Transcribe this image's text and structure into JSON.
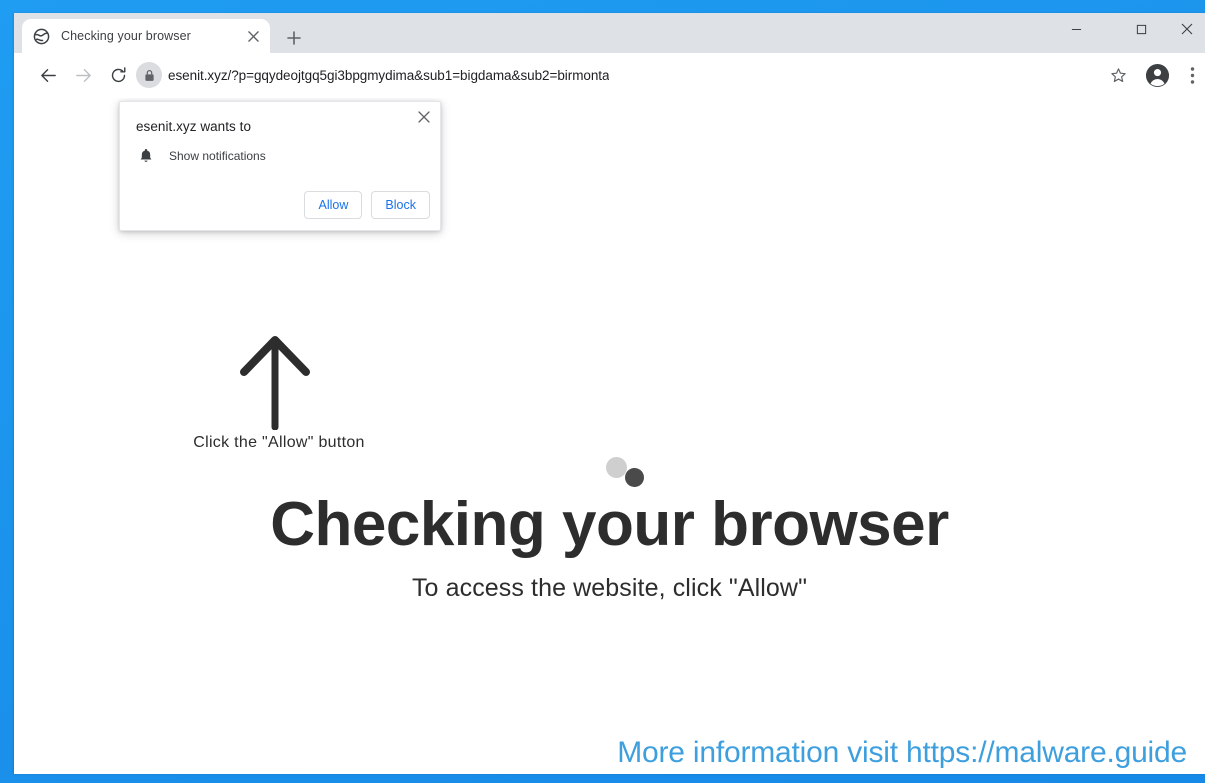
{
  "window": {
    "controls": {
      "minimize_label": "–",
      "maximize_label": "☐",
      "close_label": "✕"
    }
  },
  "tab_strip": {
    "tab": {
      "title": "Checking your browser",
      "favicon_name": "globe-favicon",
      "close_label": "✕"
    },
    "new_tab_label": "+"
  },
  "toolbar": {
    "back_icon": "back-arrow-icon",
    "forward_icon": "forward-arrow-icon",
    "reload_icon": "reload-icon",
    "lock_icon": "lock-icon",
    "url": "esenit.xyz/?p=gqydeojtgq5gi3bpgmydima&sub1=bigdama&sub2=birmonta",
    "bookmark_icon": "star-icon",
    "profile_icon": "account-avatar-icon",
    "menu_icon": "three-dot-menu-icon"
  },
  "permission_bubble": {
    "title": "esenit.xyz wants to",
    "item_label": "Show notifications",
    "item_icon": "bell-icon",
    "allow_label": "Allow",
    "block_label": "Block",
    "close_label": "✕",
    "accent_color": "#1a73e8"
  },
  "page": {
    "arrow_icon": "up-arrow-icon",
    "arrow_hint": "Click the \"Allow\" button",
    "spinner": {
      "light_dot_color": "#cfcfcf",
      "dark_dot_color": "#4a4a4a"
    },
    "heading": "Checking your browser",
    "subheading": "To access the website, click \"Allow\"",
    "footer_banner": "More information visit https://malware.guide",
    "footer_color": "#3e9fde"
  },
  "theme": {
    "frame_blue": "#1b93ec",
    "tabstrip_gray": "#dee1e6"
  }
}
